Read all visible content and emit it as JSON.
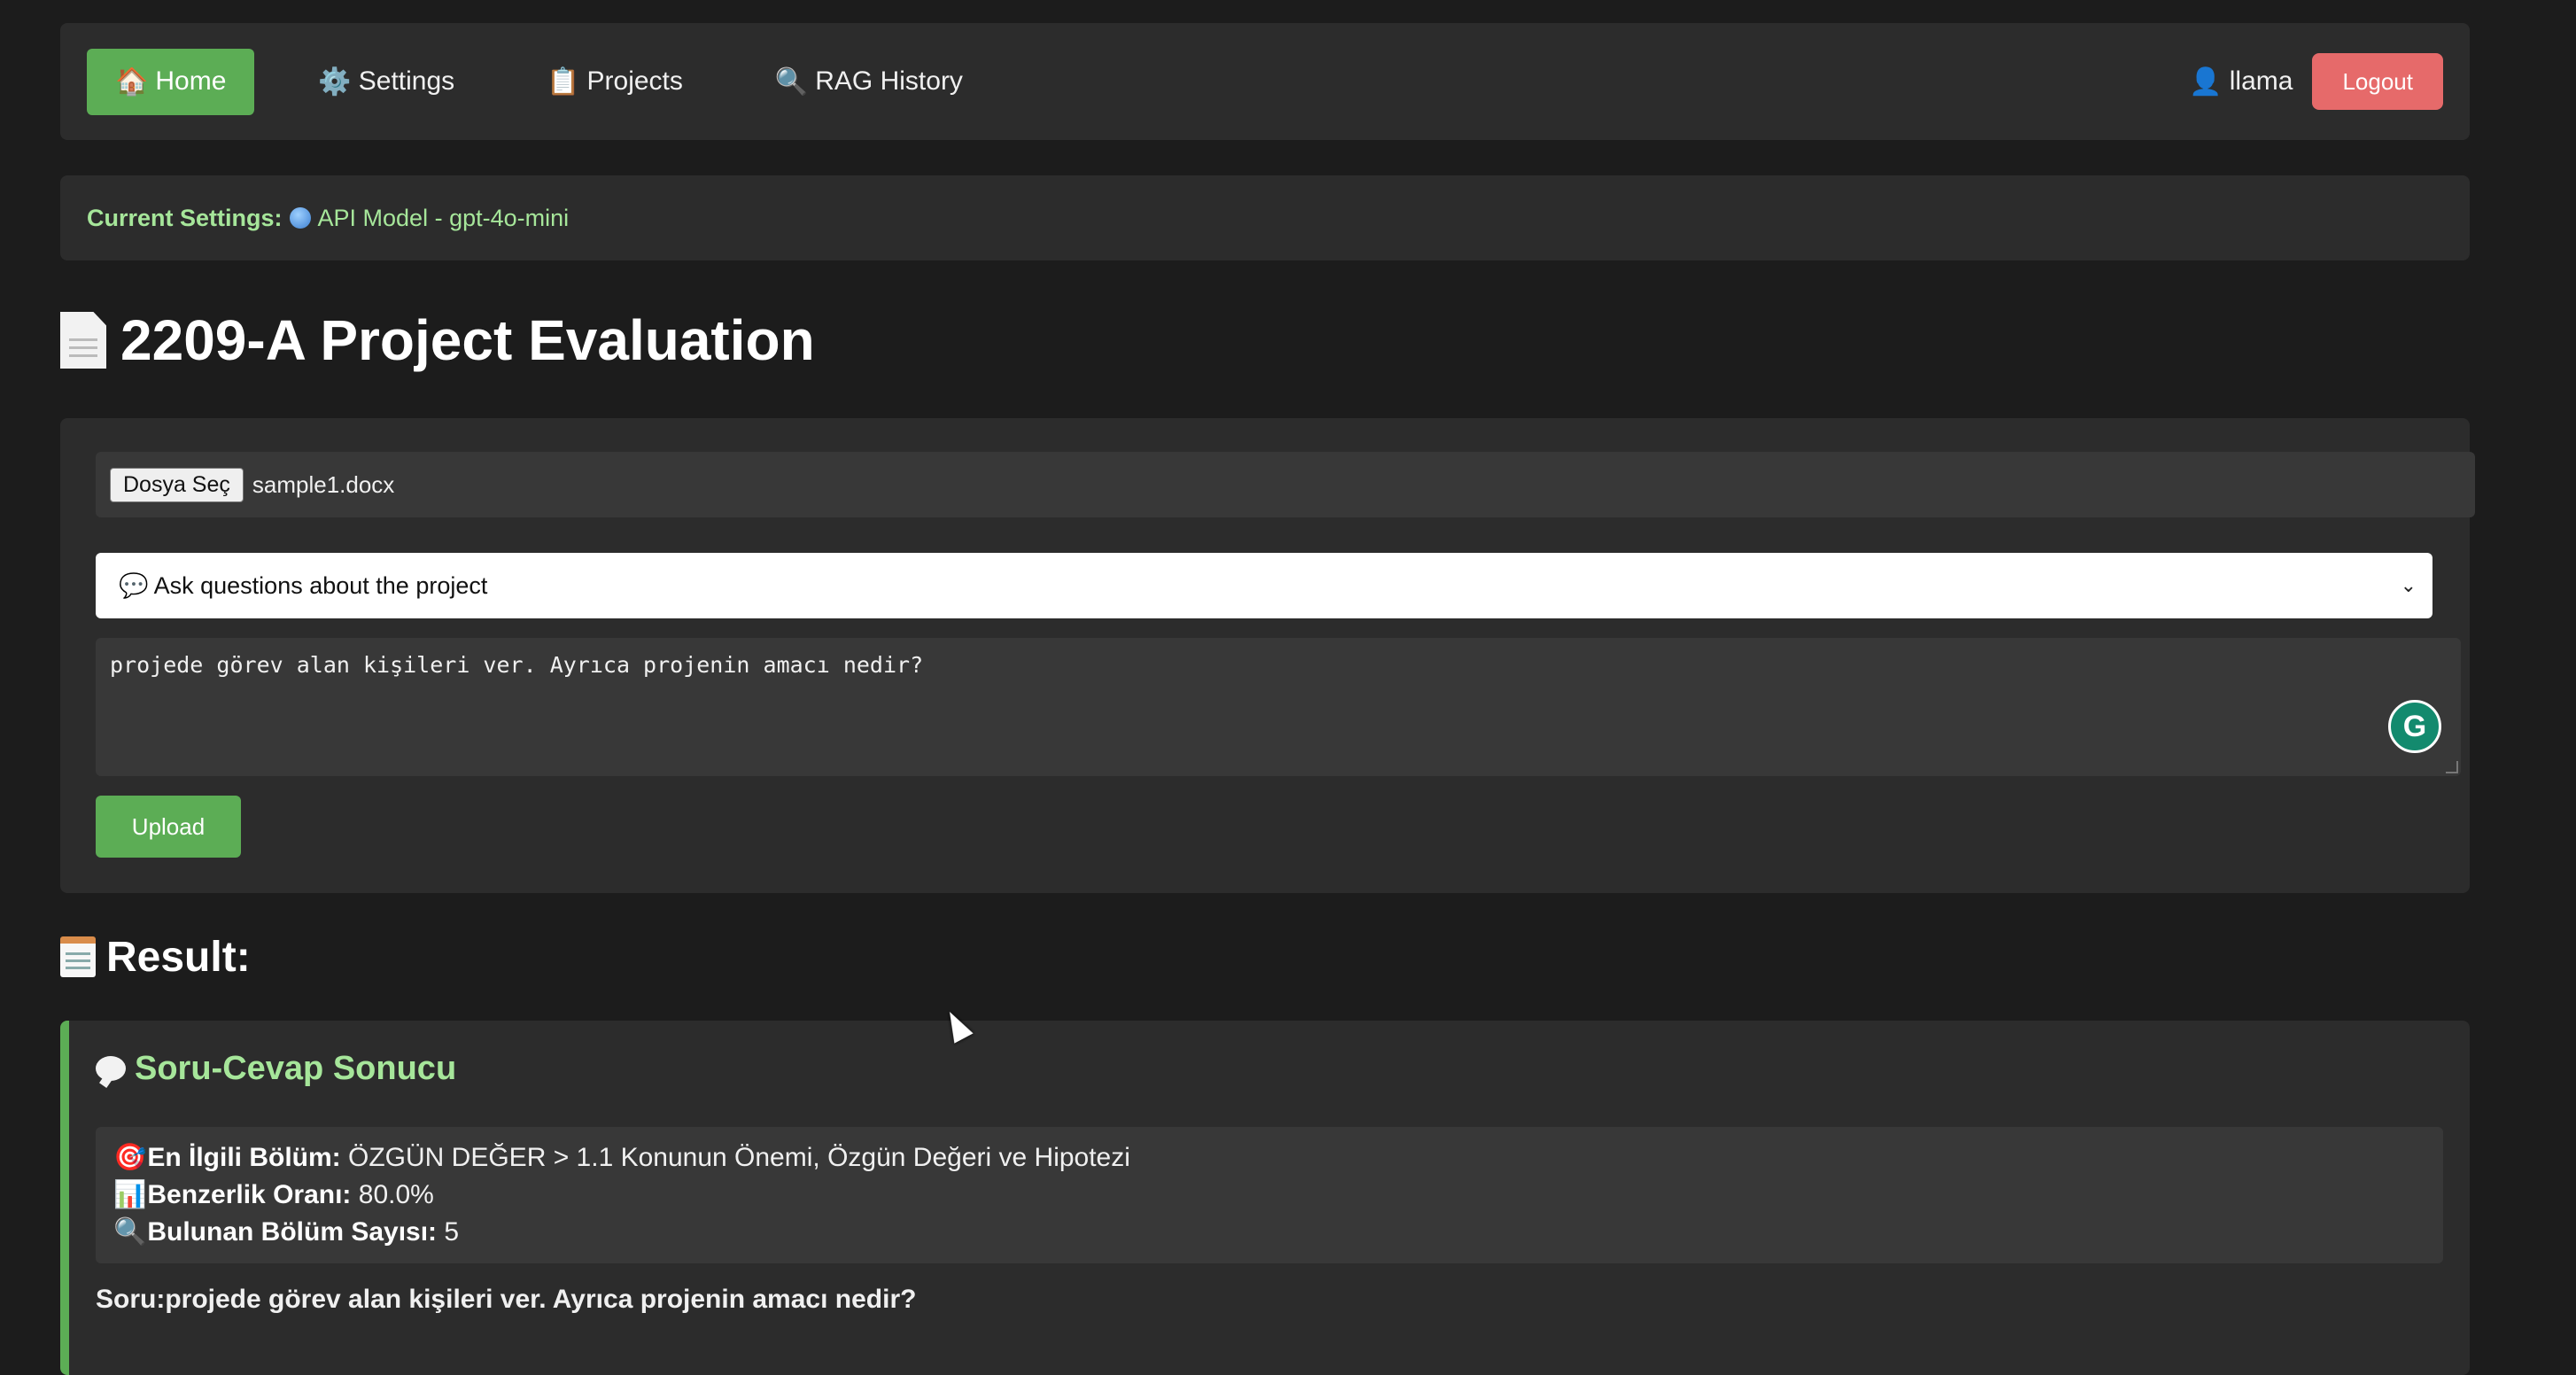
{
  "nav": {
    "items": [
      {
        "icon": "house-icon",
        "glyph": "🏠",
        "label": "Home",
        "active": true
      },
      {
        "icon": "gear-icon",
        "glyph": "⚙️",
        "label": "Settings",
        "active": false
      },
      {
        "icon": "clipboard-icon",
        "glyph": "📋",
        "label": "Projects",
        "active": false
      },
      {
        "icon": "magnifier-icon",
        "glyph": "🔍",
        "label": "RAG History",
        "active": false
      }
    ],
    "user": {
      "glyph": "👤",
      "name": "llama"
    },
    "logout_label": "Logout"
  },
  "settings": {
    "label": "Current Settings:",
    "value": "API Model - gpt-4o-mini"
  },
  "page": {
    "title": "2209-A Project Evaluation"
  },
  "form": {
    "file_button": "Dosya Seç",
    "file_name": "sample1.docx",
    "mode_select": {
      "glyph": "💬",
      "selected": "Ask questions about the project"
    },
    "question_text": "projede görev alan kişileri ver. Ayrıca projenin amacı nedir?",
    "upload_label": "Upload"
  },
  "result": {
    "heading": "Result:",
    "card_title": "Soru-Cevap Sonucu",
    "details": [
      {
        "glyph": "🎯",
        "label": "En İlgili Bölüm:",
        "value": "ÖZGÜN DEĞER > 1.1 Konunun Önemi, Özgün Değeri ve Hipotezi"
      },
      {
        "glyph": "📊",
        "label": "Benzerlik Oranı:",
        "value": "80.0%"
      },
      {
        "glyph": "🔍",
        "label": "Bulunan Bölüm Sayısı:",
        "value": "5"
      }
    ],
    "question_line": "Soru:projede görev alan kişileri ver. Ayrıca projenin amacı nedir?"
  },
  "colors": {
    "accent_green": "#5cad55",
    "logout_red": "#e66a6a",
    "settings_text": "#a6e69a",
    "background": "#1c1c1c",
    "card": "#2c2c2c"
  }
}
